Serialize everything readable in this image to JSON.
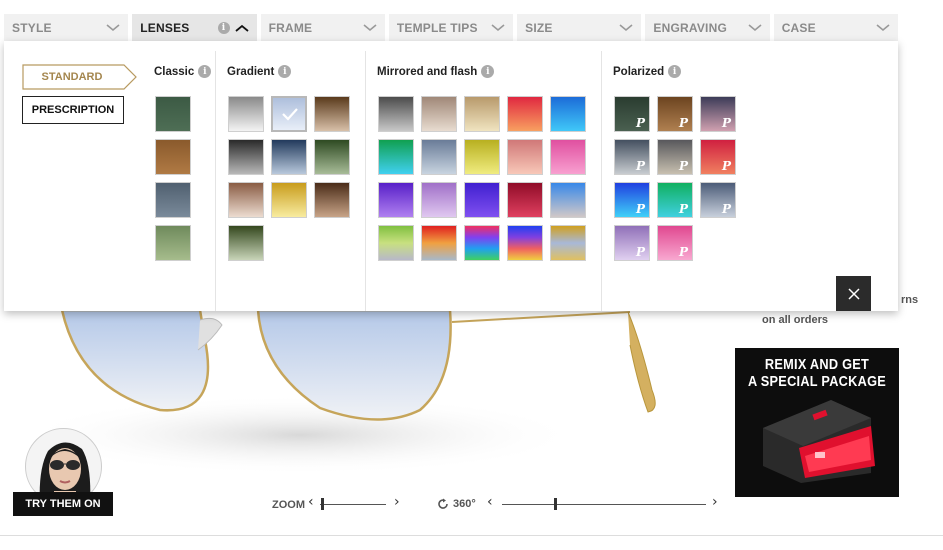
{
  "tabs": [
    {
      "label": "STYLE"
    },
    {
      "label": "LENSES"
    },
    {
      "label": "FRAME"
    },
    {
      "label": "TEMPLE TIPS"
    },
    {
      "label": "SIZE"
    },
    {
      "label": "ENGRAVING"
    },
    {
      "label": "CASE"
    }
  ],
  "lens_type": {
    "standard_label": "STANDARD",
    "prescription_label": "PRESCRIPTION"
  },
  "info_glyph": "i",
  "polarized_glyph": "P",
  "groups": {
    "classic": {
      "title": "Classic",
      "swatches": [
        {
          "colors": [
            "#3c5a44",
            "#4e6e55"
          ]
        },
        {
          "colors": [
            "#8a5a2c",
            "#b07a44"
          ]
        },
        {
          "colors": [
            "#506070",
            "#7a8a9a"
          ]
        },
        {
          "colors": [
            "#6f8a5c",
            "#a6bc8c"
          ]
        }
      ]
    },
    "gradient": {
      "title": "Gradient",
      "swatches": [
        {
          "colors": [
            "#8a8a8a",
            "#f4f4f4"
          ]
        },
        {
          "colors": [
            "#aebfdc",
            "#e8eef8"
          ],
          "selected": true
        },
        {
          "colors": [
            "#5a3a1c",
            "#d8c0a8"
          ]
        },
        {
          "colors": [
            "#2a2a2a",
            "#b8b8b8"
          ]
        },
        {
          "colors": [
            "#223a5c",
            "#b8c8dc"
          ]
        },
        {
          "colors": [
            "#2e4a22",
            "#a8bc98"
          ]
        },
        {
          "colors": [
            "#8a5c44",
            "#ecdcd0"
          ]
        },
        {
          "colors": [
            "#c89c1c",
            "#f8eca0"
          ]
        },
        {
          "colors": [
            "#4a2c18",
            "#c8a488"
          ]
        },
        {
          "colors": [
            "#34481e",
            "#c8d4b8"
          ]
        }
      ]
    },
    "mirrored": {
      "title": "Mirrored and flash",
      "swatches": [
        {
          "colors": [
            "#4c4c4c",
            "#c8c8c8"
          ]
        },
        {
          "colors": [
            "#a08878",
            "#e8dcd0"
          ]
        },
        {
          "colors": [
            "#b89a6c",
            "#f0e4c0"
          ]
        },
        {
          "colors": [
            "#e02840",
            "#f8a060"
          ]
        },
        {
          "colors": [
            "#1c6cd8",
            "#40c8f8"
          ]
        },
        {
          "colors": [
            "#10a050",
            "#40d0f0"
          ]
        },
        {
          "colors": [
            "#6a7c98",
            "#c8d4e0"
          ]
        },
        {
          "colors": [
            "#b8b020",
            "#f0ec80"
          ]
        },
        {
          "colors": [
            "#d07878",
            "#f8c8b8"
          ]
        },
        {
          "colors": [
            "#e050a0",
            "#f8a0d0"
          ]
        },
        {
          "colors": [
            "#5820c8",
            "#b080f0"
          ]
        },
        {
          "colors": [
            "#a070c8",
            "#e0c8f0"
          ]
        },
        {
          "colors": [
            "#4020d0",
            "#8050f0"
          ]
        },
        {
          "colors": [
            "#900c28",
            "#e04060"
          ]
        },
        {
          "colors": [
            "#3888e8",
            "#d0c8c8"
          ]
        },
        {
          "colors": [
            "#80c040",
            "#c8e080",
            "#b8b8c8"
          ]
        },
        {
          "colors": [
            "#e02020",
            "#f0a040",
            "#a8b8c8"
          ]
        },
        {
          "colors": [
            "#f03060",
            "#8040f0",
            "#20a0f0",
            "#40d060"
          ]
        },
        {
          "colors": [
            "#2040f0",
            "#8040e0",
            "#f06060",
            "#f0d040"
          ]
        },
        {
          "colors": [
            "#d0a020",
            "#a8b8d8",
            "#e0c060"
          ]
        }
      ]
    },
    "polarized": {
      "title": "Polarized",
      "swatches": [
        {
          "colors": [
            "#2a3c30",
            "#4a6050"
          ]
        },
        {
          "colors": [
            "#6c4420",
            "#b08050"
          ]
        },
        {
          "colors": [
            "#3c3c58",
            "#d0a0b0"
          ]
        },
        {
          "colors": [
            "#445060",
            "#c8ccd0"
          ]
        },
        {
          "colors": [
            "#58585c",
            "#c8c0b0"
          ]
        },
        {
          "colors": [
            "#d02040",
            "#f08060"
          ]
        },
        {
          "colors": [
            "#2040e0",
            "#40d0f8"
          ]
        },
        {
          "colors": [
            "#10b060",
            "#40d0e0"
          ]
        },
        {
          "colors": [
            "#4c5c78",
            "#c8d0dc"
          ]
        },
        {
          "colors": [
            "#9070b8",
            "#e0d0f0"
          ]
        },
        {
          "colors": [
            "#e04890",
            "#f8a8d0"
          ]
        }
      ]
    }
  },
  "promo": {
    "cut_text": "rns",
    "orders_text": "on all orders",
    "box_title_line1": "REMIX AND GET",
    "box_title_line2": "A SPECIAL PACKAGE"
  },
  "try_on": {
    "label": "TRY THEM ON"
  },
  "controls": {
    "zoom_label": "ZOOM",
    "rotate_label": "360°",
    "left_arrow": "‹",
    "right_arrow": "›"
  }
}
